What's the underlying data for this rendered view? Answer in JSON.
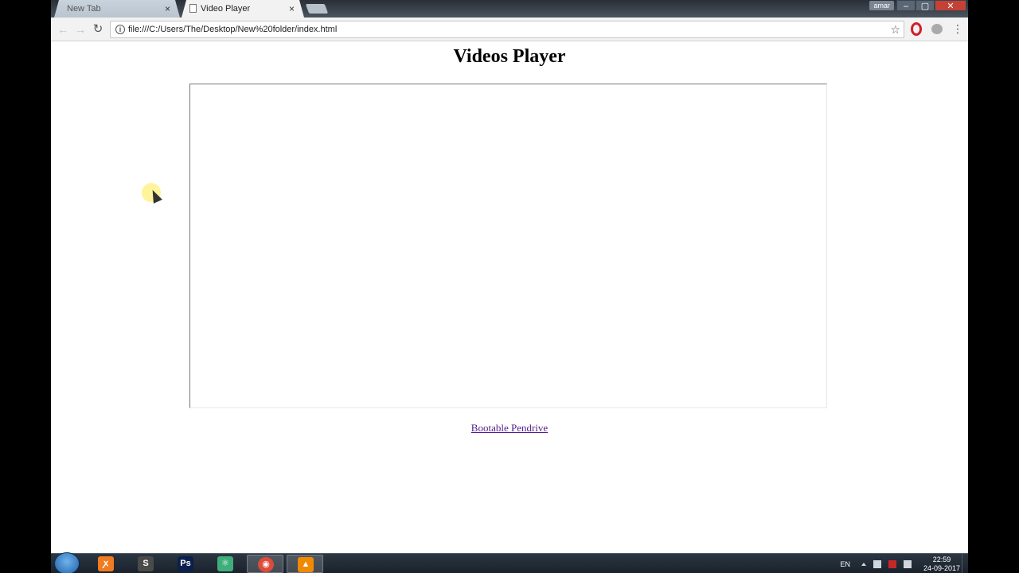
{
  "browser": {
    "tabs": [
      {
        "label": "New Tab",
        "close": "×"
      },
      {
        "label": "Video Player",
        "close": "×"
      }
    ],
    "user_badge": "amar",
    "window_controls": {
      "minimize": "–",
      "maximize": "▢",
      "close": "✕"
    },
    "url": "file:///C:/Users/The/Desktop/New%20folder/index.html",
    "icons": {
      "back": "back-arrow-icon",
      "forward": "forward-arrow-icon",
      "reload": "reload-icon",
      "info": "info-icon",
      "star": "star-icon",
      "opera": "opera-icon",
      "extension": "extension-icon",
      "menu": "menu-icon"
    }
  },
  "page": {
    "title": "Videos Player",
    "link_text": "Bootable Pendrive",
    "link_color": "#551a8b"
  },
  "taskbar": {
    "apps": [
      {
        "name": "xampp",
        "color": "#f07b21",
        "glyph": "ꭗ"
      },
      {
        "name": "sublime-text",
        "color": "#4a4a4a",
        "glyph": "S"
      },
      {
        "name": "photoshop",
        "color": "#0b1f4d",
        "glyph": "Ps"
      },
      {
        "name": "atom",
        "color": "#3fae7a",
        "glyph": "⚛"
      },
      {
        "name": "chrome",
        "color": "#dd4b39",
        "glyph": "◉"
      },
      {
        "name": "vlc",
        "color": "#f08a00",
        "glyph": "▲"
      }
    ],
    "language": "EN",
    "time": "22:59",
    "date": "24-09-2017"
  }
}
